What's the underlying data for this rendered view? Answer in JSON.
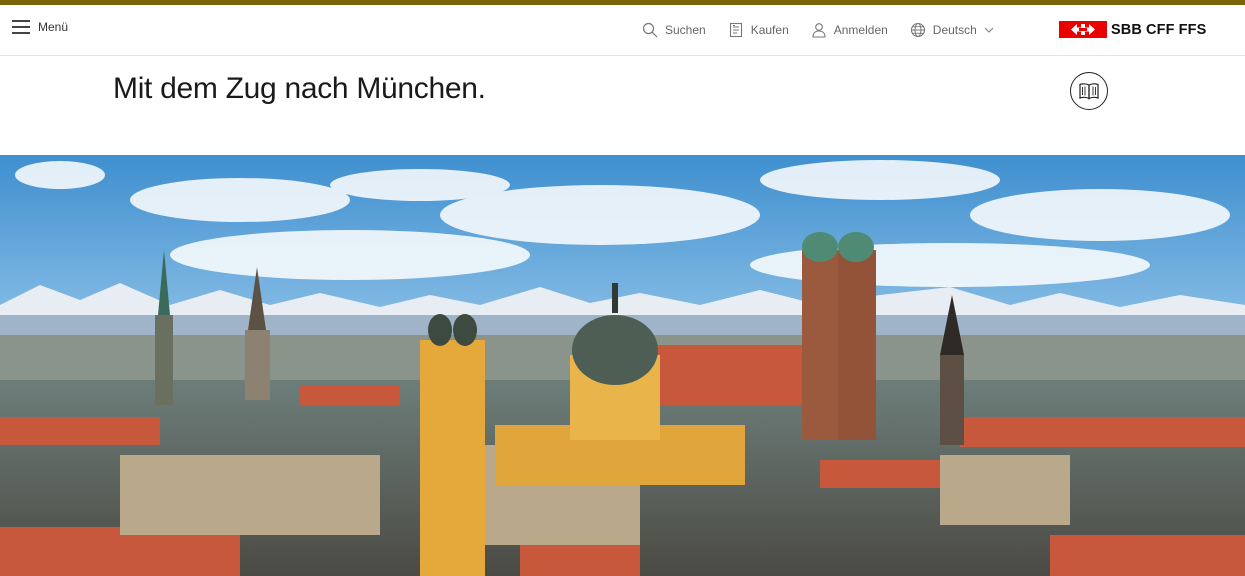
{
  "header": {
    "menu_label": "Menü",
    "search_label": "Suchen",
    "buy_label": "Kaufen",
    "login_label": "Anmelden",
    "language_label": "Deutsch",
    "logo_text": "SBB CFF FFS"
  },
  "page": {
    "title": "Mit dem Zug nach München."
  },
  "colors": {
    "accent_bar": "#7a6408",
    "brand_red": "#eb0000"
  },
  "icons": {
    "menu": "hamburger-icon",
    "search": "search-icon",
    "buy": "ticket-icon",
    "login": "user-icon",
    "language": "globe-icon",
    "brochure": "book-icon"
  }
}
